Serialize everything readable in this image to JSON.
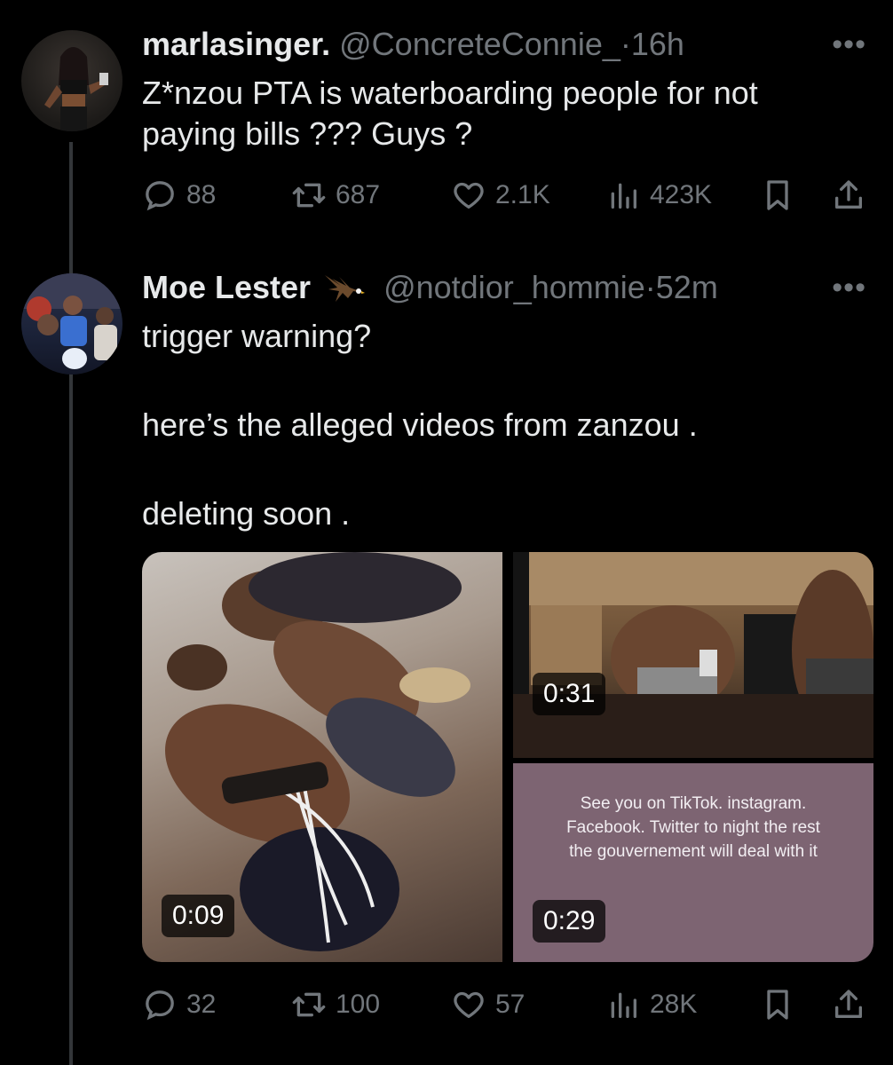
{
  "tweets": [
    {
      "author": "marlasinger.",
      "handle": "@ConcreteConnie_",
      "dot": "·",
      "time": "16h",
      "more": "•••",
      "lines": [
        "Z*nzou PTA is waterboarding people for not",
        "paying bills ??? Guys ?"
      ],
      "stats": {
        "replies": "88",
        "retweets": "687",
        "likes": "2.1K",
        "views": "423K"
      }
    },
    {
      "author": "Moe Lester",
      "badge_icon": "eagle-emoji",
      "handle": "@notdior_hommie",
      "dot": "·",
      "time": "52m",
      "more": "•••",
      "lines": [
        "trigger warning?",
        "here’s the alleged videos from zanzou .",
        "deleting soon ."
      ],
      "media": {
        "videos": [
          {
            "duration": "0:09"
          },
          {
            "duration": "0:31"
          },
          {
            "duration": "0:29",
            "overlay_text": [
              "See you on TikTok. instagram.",
              "Facebook. Twitter  to night the rest",
              "the gouvernement will deal with it"
            ]
          }
        ]
      },
      "stats": {
        "replies": "32",
        "retweets": "100",
        "likes": "57",
        "views": "28K"
      }
    }
  ],
  "icons": {
    "reply": "reply-icon",
    "retweet": "retweet-icon",
    "like": "heart-icon",
    "views": "views-icon",
    "bookmark": "bookmark-icon",
    "share": "share-icon"
  }
}
